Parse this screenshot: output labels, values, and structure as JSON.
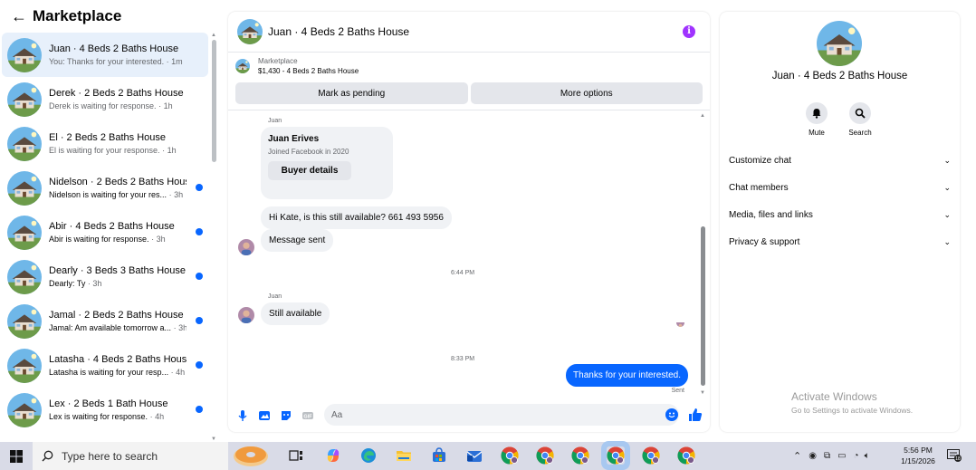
{
  "sidebar": {
    "title": "Marketplace",
    "back_icon": "left-arrow-icon",
    "conversations": [
      {
        "name": "Juan · 4 Beds 2 Baths House",
        "preview": "You: Thanks for your interested.",
        "time": "· 1m",
        "unread": false,
        "active": true
      },
      {
        "name": "Derek · 2 Beds 2 Baths House",
        "preview": "Derek is waiting for response.",
        "time": "· 1h",
        "unread": false,
        "active": false
      },
      {
        "name": "El · 2 Beds 2 Baths House",
        "preview": "El is waiting for your response.",
        "time": "· 1h",
        "unread": false,
        "active": false
      },
      {
        "name": "Nidelson · 2 Beds 2 Baths House",
        "preview": "Nidelson is waiting for your res...",
        "time": "· 3h",
        "unread": true,
        "active": false
      },
      {
        "name": "Abir · 4 Beds 2 Baths House",
        "preview": "Abir is waiting for response.",
        "time": "· 3h",
        "unread": true,
        "active": false
      },
      {
        "name": "Dearly · 3 Beds 3 Baths House",
        "preview": "Dearly: Ty",
        "time": "· 3h",
        "unread": true,
        "active": false
      },
      {
        "name": "Jamal · 2 Beds 2 Baths House",
        "preview": "Jamal: Am available tomorrow a...",
        "time": "· 3h",
        "unread": true,
        "active": false
      },
      {
        "name": "Latasha · 4 Beds 2 Baths House",
        "preview": "Latasha is waiting for your resp...",
        "time": "· 4h",
        "unread": true,
        "active": false
      },
      {
        "name": "Lex · 2 Beds 1 Bath House",
        "preview": "Lex is waiting for response.",
        "time": "· 4h",
        "unread": true,
        "active": false
      }
    ]
  },
  "chat": {
    "title": "Juan · 4 Beds 2 Baths House",
    "listing_label": "Marketplace",
    "listing_detail": "$1,430 - 4 Beds 2 Baths House",
    "mark_pending": "Mark as pending",
    "more_options": "More options",
    "sender_label_1": "Juan",
    "card_name": "Juan Erives",
    "card_joined": "Joined Facebook in 2020",
    "buyer_details": "Buyer details",
    "msg_1": "Hi Kate, is this still available? 661 493 5956",
    "msg_2": "Message sent",
    "time_1": "6:44 PM",
    "sender_label_2": "Juan",
    "msg_3": "Still available",
    "time_2": "8:33 PM",
    "msg_out": "Thanks for your  interested.",
    "sent_label": "Sent",
    "composer_placeholder": "Aa",
    "accent": "#0866ff"
  },
  "info_panel": {
    "name": "Juan · 4 Beds 2 Baths House",
    "mute_label": "Mute",
    "search_label": "Search",
    "rows": [
      "Customize chat",
      "Chat members",
      "Media, files and links",
      "Privacy & support"
    ],
    "activate_title": "Activate Windows",
    "activate_sub": "Go to Settings to activate Windows."
  },
  "taskbar": {
    "search_placeholder": "Type here to search",
    "time": "5:56 PM",
    "date": "1/15/2026",
    "notification_count": "18"
  }
}
